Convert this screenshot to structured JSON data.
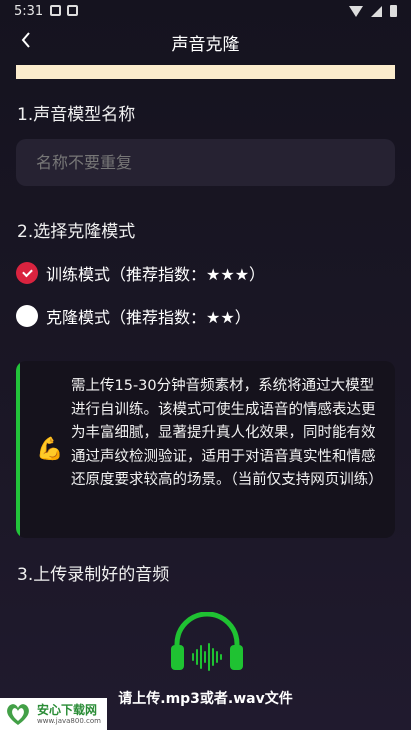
{
  "status": {
    "time": "5:31"
  },
  "header": {
    "title": "声音克隆"
  },
  "section1": {
    "title": "1.声音模型名称",
    "placeholder": "名称不要重复",
    "value": ""
  },
  "section2": {
    "title": "2.选择克隆模式",
    "options": [
      {
        "label": "训练模式（推荐指数：★★★）",
        "selected": true
      },
      {
        "label": "克隆模式（推荐指数：★★）",
        "selected": false
      }
    ]
  },
  "info": {
    "emoji": "💪",
    "text": "需上传15-30分钟音频素材，系统将通过大模型进行自训练。该模式可使生成语音的情感表达更为丰富细腻，显著提升真人化效果，同时能有效通过声纹检测验证，适用于对语音真实性和情感还原度要求较高的场景。（当前仅支持网页训练）",
    "accent_color": "#22c33a"
  },
  "section3": {
    "title": "3.上传录制好的音频",
    "upload_label": "请上传.mp3或者.wav文件",
    "icon": "headphones-icon",
    "icon_color": "#1fc232"
  },
  "watermark": {
    "name": "安心下载网",
    "url": "www.java800.com"
  }
}
